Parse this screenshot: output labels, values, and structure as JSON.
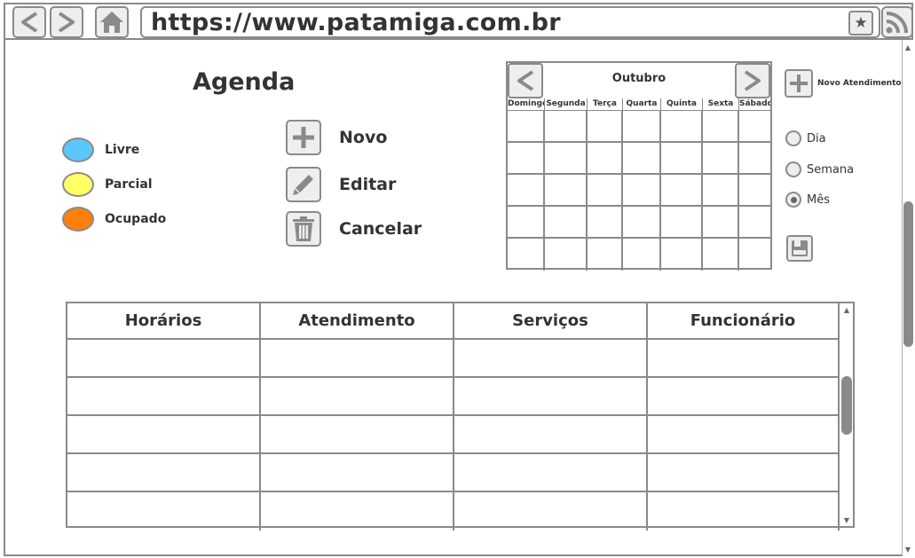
{
  "browser": {
    "url": "https://www.patamiga.com.br",
    "back_icon": "chevron-left-icon",
    "forward_icon": "chevron-right-icon",
    "home_icon": "home-icon",
    "bookmark_icon": "star-icon",
    "feed_icon": "rss-icon"
  },
  "page": {
    "title": "Agenda"
  },
  "legend": [
    {
      "label": "Livre",
      "color": "#5bc8fd"
    },
    {
      "label": "Parcial",
      "color": "#ffff66"
    },
    {
      "label": "Ocupado",
      "color": "#ff7f0a"
    }
  ],
  "actions": {
    "new_label": "Novo",
    "edit_label": "Editar",
    "cancel_label": "Cancelar"
  },
  "calendar": {
    "month": "Outubro",
    "weekdays": [
      "Domingo",
      "Segunda",
      "Terça",
      "Quarta",
      "Quinta",
      "Sexta",
      "Sábado"
    ],
    "weeks": 5
  },
  "sidebar": {
    "new_appointment_label": "Novo Atendimento",
    "view_options": [
      {
        "label": "Dia",
        "selected": false
      },
      {
        "label": "Semana",
        "selected": false
      },
      {
        "label": "Mês",
        "selected": true
      }
    ],
    "save_icon": "save-icon"
  },
  "table": {
    "columns": [
      "Horários",
      "Atendimento",
      "Serviços",
      "Funcionário"
    ],
    "rows": [
      [
        "",
        "",
        "",
        ""
      ],
      [
        "",
        "",
        "",
        ""
      ],
      [
        "",
        "",
        "",
        ""
      ],
      [
        "",
        "",
        "",
        ""
      ],
      [
        "",
        "",
        "",
        ""
      ]
    ]
  },
  "colors": {
    "border": "#8a8a8a",
    "button_bg": "#eeeeee",
    "text": "#333333"
  }
}
